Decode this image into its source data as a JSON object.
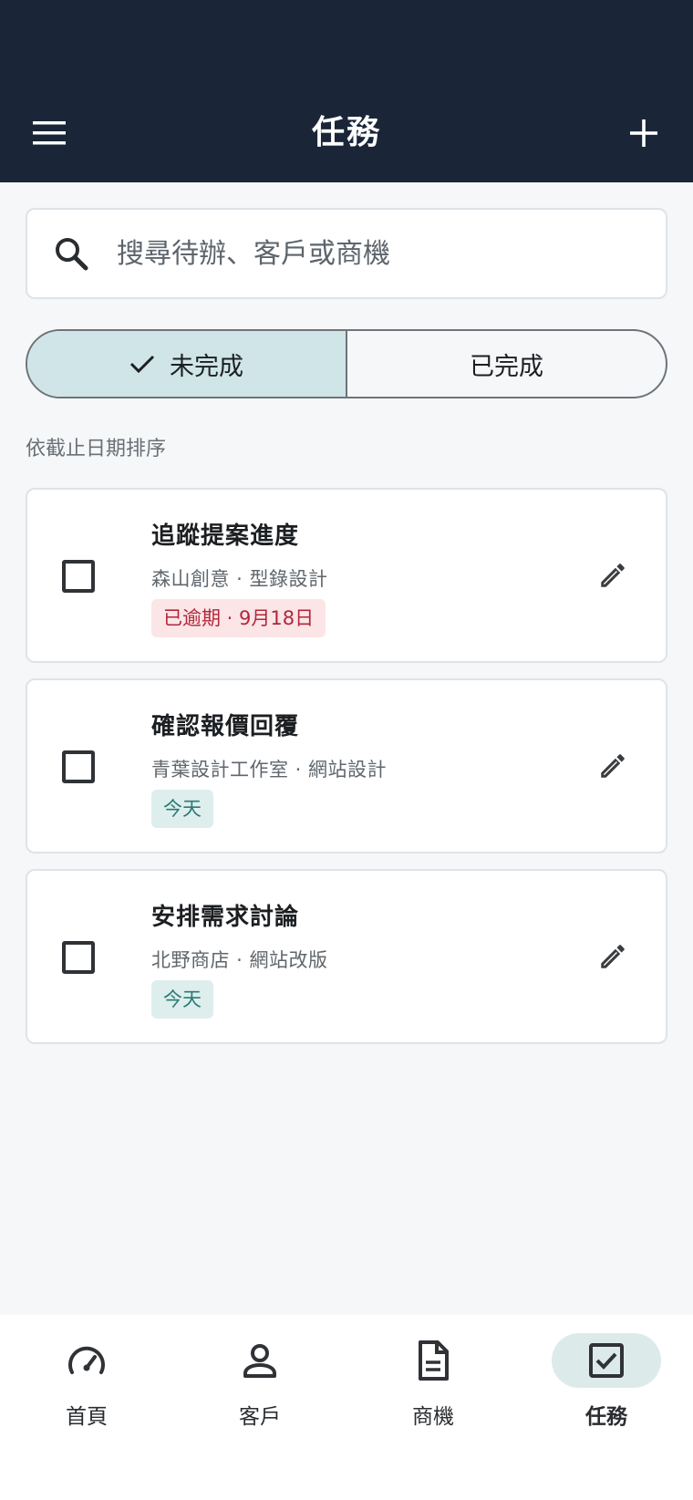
{
  "header": {
    "title": "任務"
  },
  "search": {
    "placeholder": "搜尋待辦、客戶或商機"
  },
  "filter": {
    "tabs": [
      {
        "label": "未完成",
        "active": true
      },
      {
        "label": "已完成",
        "active": false
      }
    ]
  },
  "sort_label": "依截止日期排序",
  "tasks": [
    {
      "title": "追蹤提案進度",
      "subtitle": "森山創意 · 型錄設計",
      "badge": "已逾期 · 9月18日",
      "badge_type": "overdue"
    },
    {
      "title": "確認報價回覆",
      "subtitle": "青葉設計工作室 · 網站設計",
      "badge": "今天",
      "badge_type": "today"
    },
    {
      "title": "安排需求討論",
      "subtitle": "北野商店 · 網站改版",
      "badge": "今天",
      "badge_type": "today"
    }
  ],
  "bottom_nav": {
    "items": [
      {
        "label": "首頁",
        "icon": "speedometer-icon",
        "active": false
      },
      {
        "label": "客戶",
        "icon": "person-icon",
        "active": false
      },
      {
        "label": "商機",
        "icon": "document-icon",
        "active": false
      },
      {
        "label": "任務",
        "icon": "checkbox-icon",
        "active": true
      }
    ]
  },
  "colors": {
    "header_bg": "#1a2638",
    "active_tab_bg": "#cfe5e8",
    "overdue_text": "#b3263a",
    "overdue_bg": "#fbe5e7",
    "today_text": "#2c7a76",
    "today_bg": "#ddeeed"
  }
}
